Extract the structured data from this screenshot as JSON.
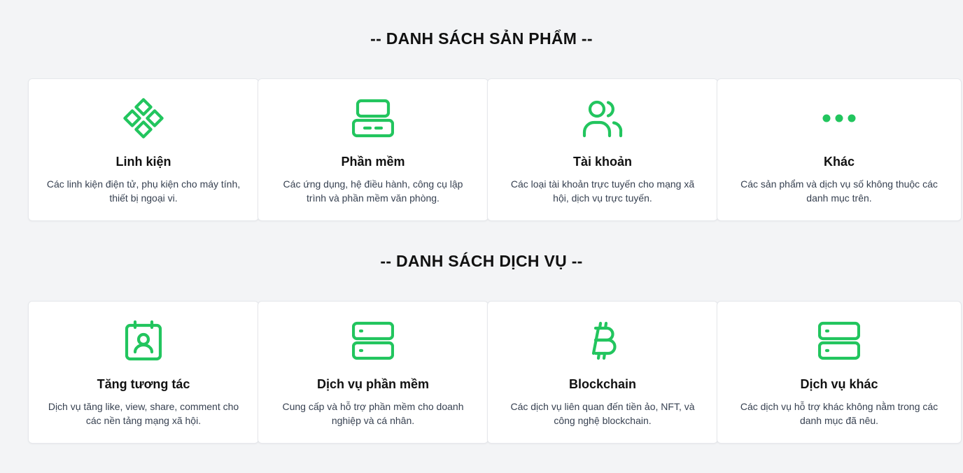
{
  "colors": {
    "accent": "#22c55e",
    "background": "#f3f4f6",
    "card": "#ffffff"
  },
  "products": {
    "heading": "-- DANH SÁCH SẢN PHẨM --",
    "cards": [
      {
        "icon": "diamond-grid-icon",
        "title": "Linh kiện",
        "description": "Các linh kiện điện tử, phụ kiện cho máy tính, thiết bị ngoại vi."
      },
      {
        "icon": "app-window-icon",
        "title": "Phần mềm",
        "description": "Các ứng dụng, hệ điều hành, công cụ lập trình và phần mềm văn phòng."
      },
      {
        "icon": "users-icon",
        "title": "Tài khoản",
        "description": "Các loại tài khoản trực tuyến cho mạng xã hội, dịch vụ trực tuyến."
      },
      {
        "icon": "more-dots-icon",
        "title": "Khác",
        "description": "Các sản phẩm và dịch vụ số không thuộc các danh mục trên."
      }
    ]
  },
  "services": {
    "heading": "-- DANH SÁCH DỊCH VỤ --",
    "cards": [
      {
        "icon": "contact-card-icon",
        "title": "Tăng tương tác",
        "description": "Dịch vụ tăng like, view, share, comment cho các nền tảng mạng xã hội."
      },
      {
        "icon": "server-icon",
        "title": "Dịch vụ phần mềm",
        "description": "Cung cấp và hỗ trợ phần mềm cho doanh nghiệp và cá nhân."
      },
      {
        "icon": "bitcoin-icon",
        "title": "Blockchain",
        "description": "Các dịch vụ liên quan đến tiền ảo, NFT, và công nghệ blockchain."
      },
      {
        "icon": "server-icon",
        "title": "Dịch vụ khác",
        "description": "Các dịch vụ hỗ trợ khác không nằm trong các danh mục đã nêu."
      }
    ]
  }
}
